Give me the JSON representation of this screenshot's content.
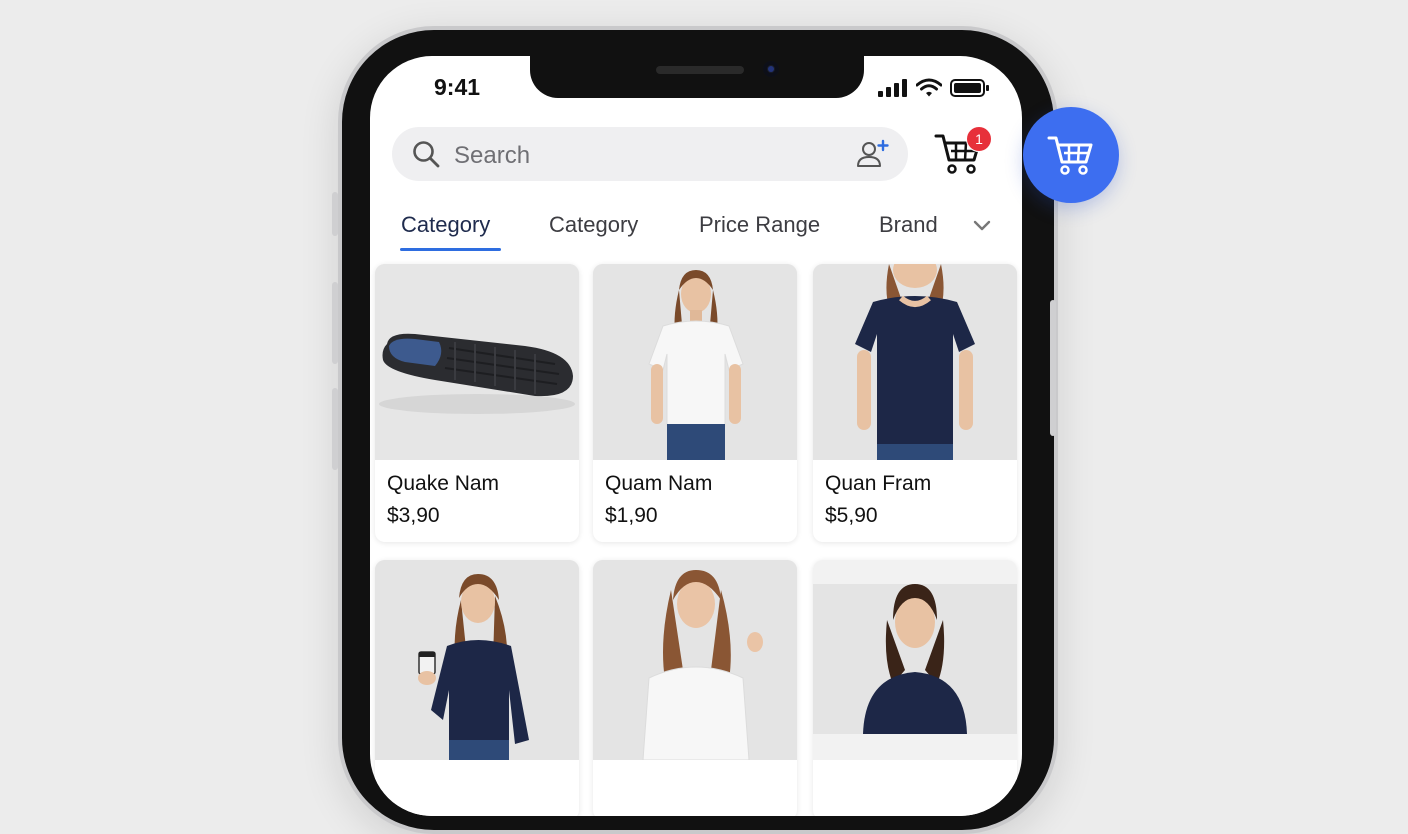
{
  "status_bar": {
    "time": "9:41"
  },
  "search": {
    "placeholder": "Search"
  },
  "cart": {
    "badge_count": "1"
  },
  "filters": {
    "tabs": [
      {
        "label": "Category",
        "active": true
      },
      {
        "label": "Category",
        "active": false
      },
      {
        "label": "Price Range",
        "active": false
      },
      {
        "label": "Brand",
        "active": false
      }
    ]
  },
  "products": [
    {
      "name": "Quake Nam",
      "price": "$3,90",
      "image": "shoe-sole"
    },
    {
      "name": "Quam Nam",
      "price": "$1,90",
      "image": "white-tshirt-model"
    },
    {
      "name": "Quan Fram",
      "price": "$5,90",
      "image": "navy-tshirt-model"
    },
    {
      "name": "",
      "price": "",
      "image": "navy-longsleeve-coffee-model"
    },
    {
      "name": "",
      "price": "",
      "image": "white-tshirt-model-2"
    },
    {
      "name": "",
      "price": "",
      "image": "navy-top-model-portrait"
    }
  ],
  "colors": {
    "accent": "#2e6de0",
    "fab": "#3d6ef0",
    "badge": "#e7303a",
    "navy": "#1d2747"
  },
  "icons": [
    "search-icon",
    "add-person-icon",
    "cart-icon",
    "chevron-down-icon",
    "signal-icon",
    "wifi-icon",
    "battery-icon"
  ]
}
